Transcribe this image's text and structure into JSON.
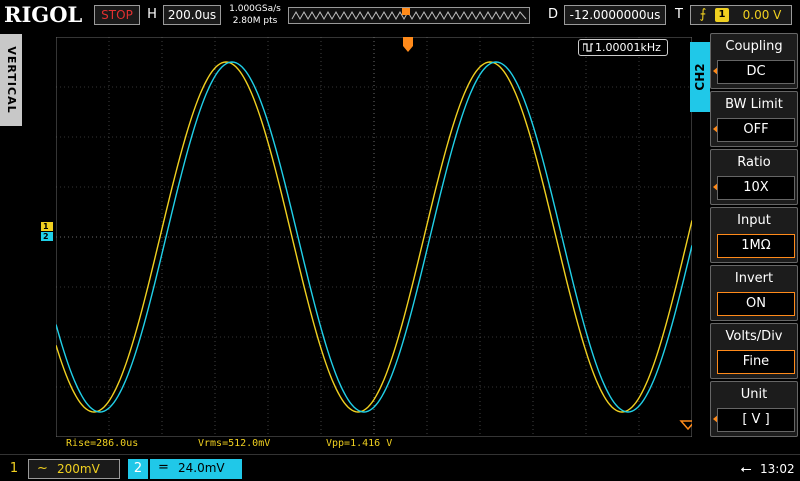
{
  "header": {
    "brand": "RIGOL",
    "run_state": "STOP",
    "horizontal_label": "H",
    "timebase": "200.0us",
    "sample_rate": "1.000GSa/s",
    "memory_depth": "2.80M pts",
    "delay_label": "D",
    "delay": "-12.0000000us",
    "trigger_label": "T",
    "trigger_source": "1",
    "trigger_level": "0.00 V",
    "trigger_edge_icon": "rising-edge-icon"
  },
  "sidebar": {
    "vertical_tab": "VERTICAL"
  },
  "screen": {
    "frequency": "1.00001kHz",
    "ch1_marker": "1",
    "ch2_marker": "2",
    "measurements": [
      {
        "text": "Rise=286.0us"
      },
      {
        "text": "Vrms=512.0mV"
      },
      {
        "text": "Vpp=1.416 V"
      }
    ]
  },
  "menu": {
    "channel_tab": "CH2",
    "items": [
      {
        "title": "Coupling",
        "value": "DC",
        "arrow": true,
        "selected": false
      },
      {
        "title": "BW Limit",
        "value": "OFF",
        "arrow": true,
        "selected": false
      },
      {
        "title": "Ratio",
        "value": "10X",
        "arrow": true,
        "selected": false
      },
      {
        "title": "Input",
        "value": "1MΩ",
        "arrow": false,
        "selected": true
      },
      {
        "title": "Invert",
        "value": "ON",
        "arrow": false,
        "selected": true
      },
      {
        "title": "Volts/Div",
        "value": "Fine",
        "arrow": false,
        "selected": true
      },
      {
        "title": "Unit",
        "value": "[ V ]",
        "arrow": true,
        "selected": false
      }
    ]
  },
  "footer": {
    "ch1_number": "1",
    "ch1_coupling": "~",
    "ch1_scale": "200mV",
    "ch2_number": "2",
    "ch2_coupling": "=",
    "ch2_scale": "24.0mV",
    "clock": "13:02"
  },
  "colors": {
    "ch1": "#f0d020",
    "ch2": "#20d0e8",
    "accent": "#ff8a1a",
    "grid": "#6a6a6a"
  }
}
